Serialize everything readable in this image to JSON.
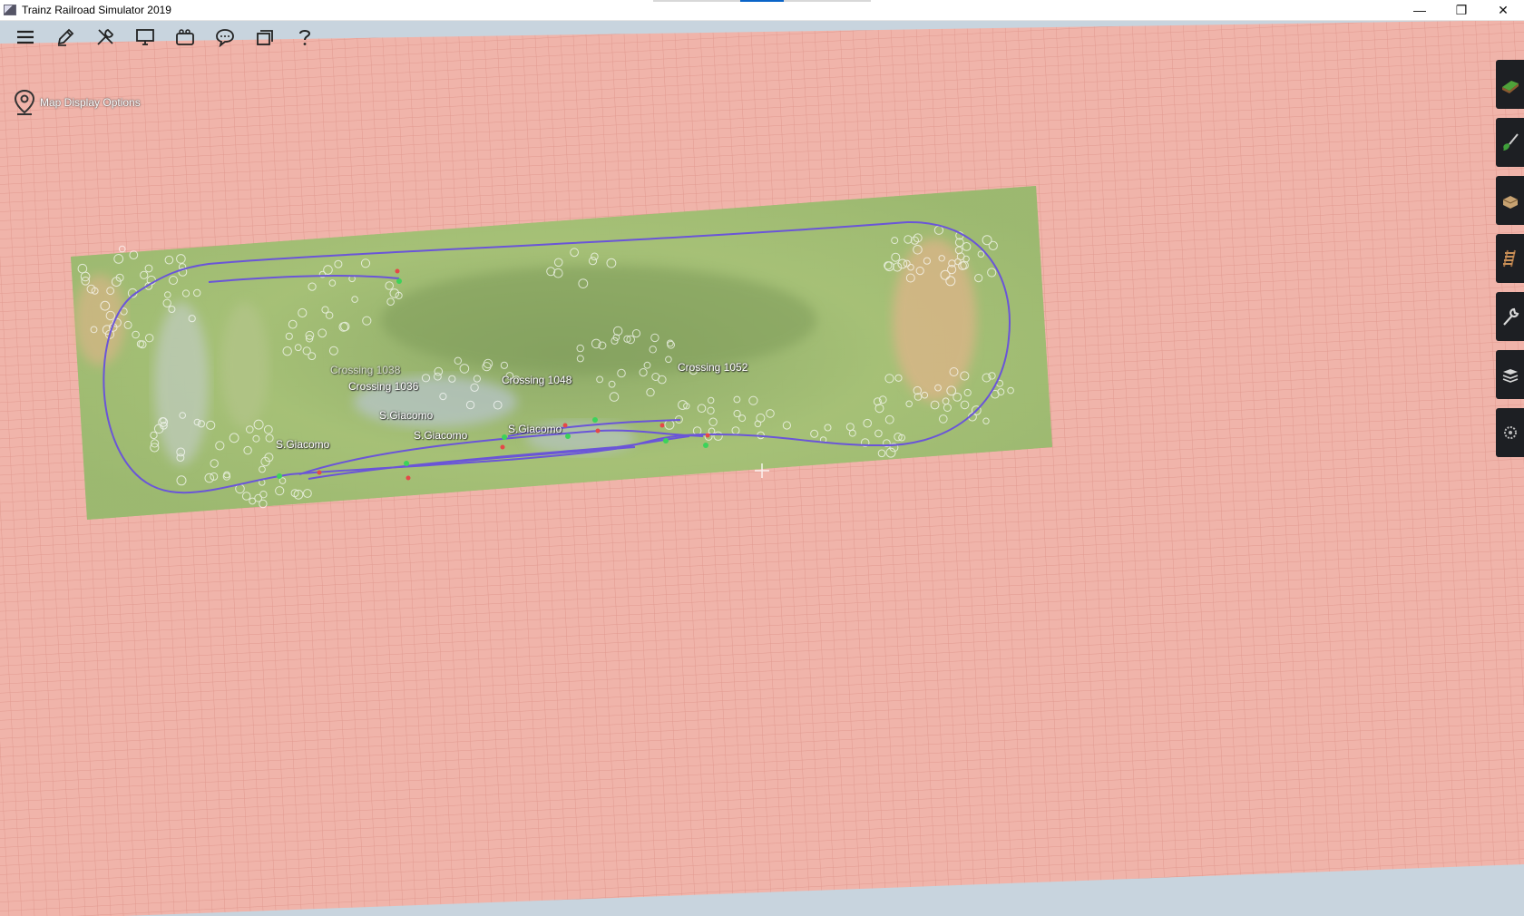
{
  "window": {
    "title": "Trainz Railroad Simulator 2019",
    "minimize_glyph": "—",
    "restore_glyph": "❐",
    "close_glyph": "✕"
  },
  "toolbar": {
    "items": [
      {
        "icon": "menu-icon"
      },
      {
        "icon": "edit-icon"
      },
      {
        "icon": "tools-icon"
      },
      {
        "icon": "monitor-icon"
      },
      {
        "icon": "camera-icon"
      },
      {
        "icon": "chat-icon"
      },
      {
        "icon": "windows-icon"
      },
      {
        "icon": "help-icon"
      }
    ]
  },
  "map": {
    "display_options_label": "Map Display Options",
    "labels": {
      "crossing_1038": "Crossing 1038",
      "crossing_1036": "Crossing 1036",
      "crossing_1048": "Crossing 1048",
      "crossing_1052": "Crossing 1052",
      "station_1": "S.Giacomo",
      "station_2": "S.Giacomo",
      "station_3": "S.Giacomo",
      "station_4": "S.Giacomo"
    }
  },
  "palette": {
    "tools": [
      {
        "icon": "terrain-tool-icon"
      },
      {
        "icon": "paint-tool-icon"
      },
      {
        "icon": "objects-tool-icon"
      },
      {
        "icon": "track-tool-icon"
      },
      {
        "icon": "wrench-tool-icon"
      },
      {
        "icon": "layers-tool-icon"
      },
      {
        "icon": "settings-tool-icon"
      }
    ]
  },
  "colors": {
    "baseboard": "#f0b4aa",
    "grid_line": "#e59c92",
    "terrain": "#9fbf6e",
    "track": "#6a55d8",
    "palette_bg": "#1d1f23"
  }
}
